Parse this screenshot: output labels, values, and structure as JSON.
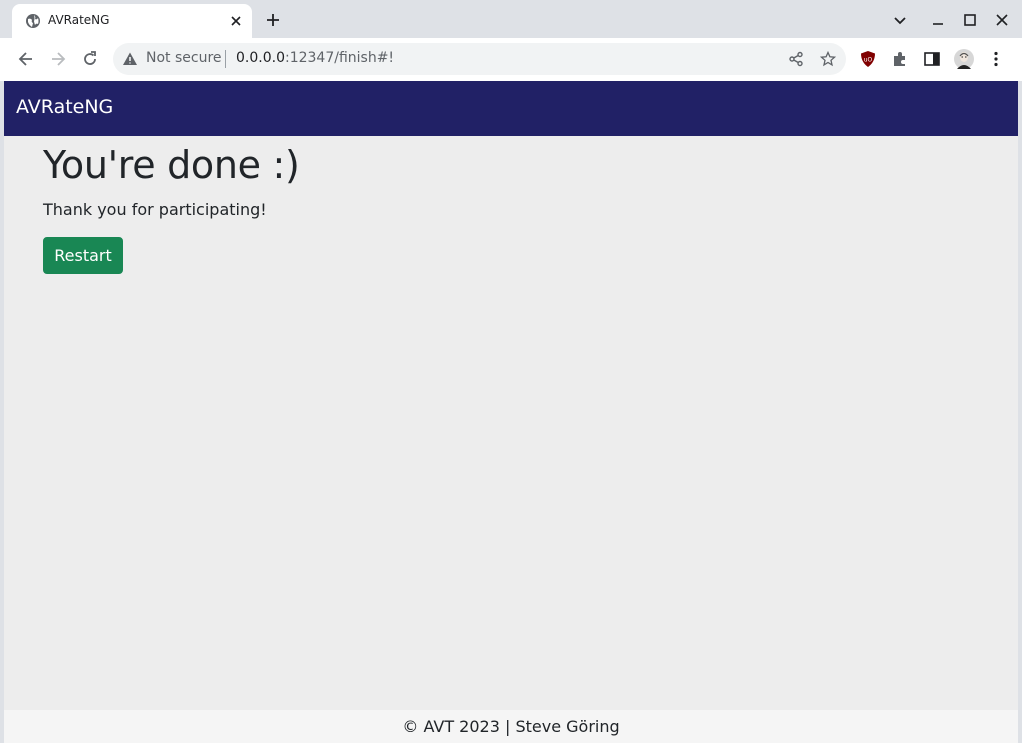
{
  "browser": {
    "tab": {
      "title": "AVRateNG",
      "favicon": "globe-icon"
    },
    "address_bar": {
      "security_label": "Not secure",
      "url_host": "0.0.0.0",
      "url_rest": ":12347/finish#!"
    },
    "icons": {
      "back": "arrow-left-icon",
      "forward": "arrow-right-icon",
      "reload": "reload-icon",
      "share": "share-icon",
      "bookmark": "star-icon",
      "ublock": "ublock-icon",
      "extensions": "puzzle-icon",
      "side_panel": "side-panel-icon",
      "profile": "avatar",
      "menu": "kebab-menu-icon"
    }
  },
  "navbar": {
    "brand": "AVRateNG",
    "bg_color": "#212166"
  },
  "main": {
    "title": "You're done :)",
    "message": "Thank you for participating!",
    "restart_label": "Restart",
    "button_color": "#198754"
  },
  "footer": {
    "text": "© AVT 2023 | Steve Göring"
  }
}
